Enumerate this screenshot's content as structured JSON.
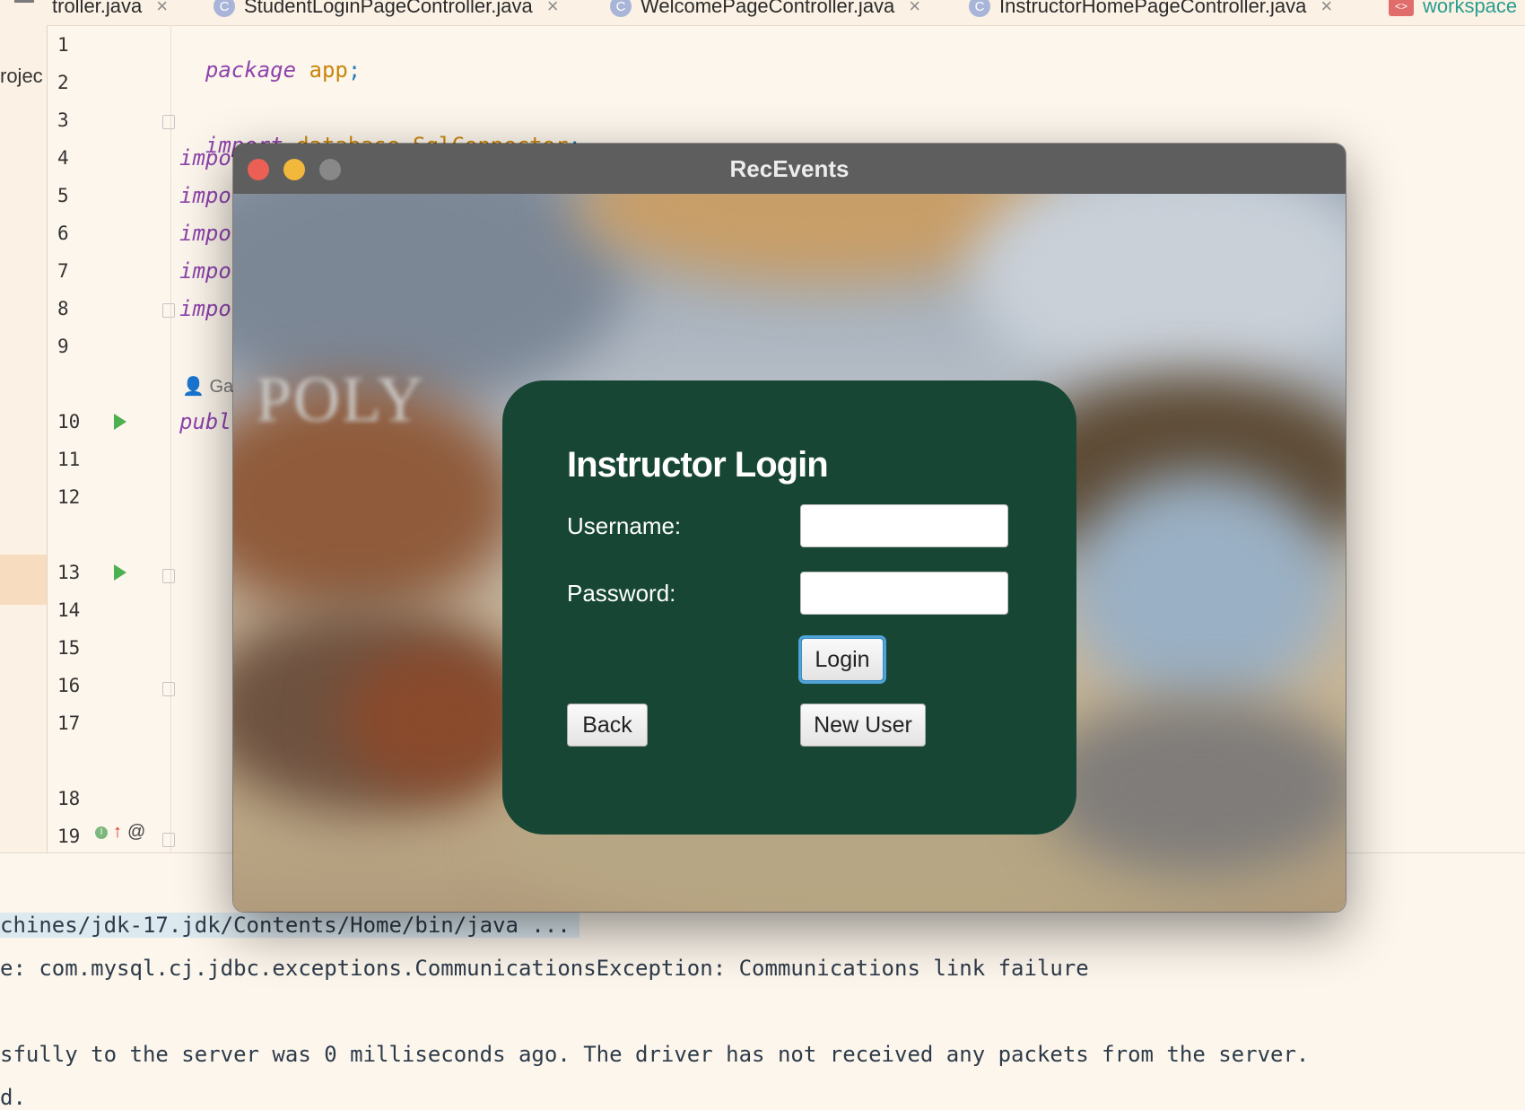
{
  "ide": {
    "tabs": [
      {
        "label": "troller.java",
        "icon": "class-icon"
      },
      {
        "label": "StudentLoginPageController.java",
        "icon": "class-icon"
      },
      {
        "label": "WelcomePageController.java",
        "icon": "class-icon"
      },
      {
        "label": "InstructorHomePageController.java",
        "icon": "class-icon"
      },
      {
        "label": "workspace",
        "icon": "xml-icon"
      }
    ],
    "project_label": "rojec",
    "line_numbers": [
      "1",
      "2",
      "3",
      "4",
      "5",
      "6",
      "7",
      "8",
      "9",
      "10",
      "11",
      "12",
      "13",
      "14",
      "15",
      "16",
      "17",
      "18",
      "19"
    ],
    "code": {
      "line1_kw": "package",
      "line1_pkg": "app",
      "line3_kw": "import",
      "line3_pkg": "database.SqlConnector",
      "semi": ";",
      "impo": "impo",
      "publ": "publ"
    },
    "author_hint": "Gab",
    "gutter_at": "@",
    "console": {
      "line1": "chines/jdk-17.jdk/Contents/Home/bin/java ...",
      "line2": "e: com.mysql.cj.jdbc.exceptions.CommunicationsException: Communications link failure",
      "line3": "sfully to the server was 0 milliseconds ago. The driver has not received any packets from the server.",
      "line4": "d."
    }
  },
  "window": {
    "title": "RecEvents",
    "background_text": "POLY"
  },
  "login": {
    "title": "Instructor Login",
    "username_label": "Username:",
    "password_label": "Password:",
    "username_value": "",
    "password_value": "",
    "login_button": "Login",
    "back_button": "Back",
    "new_user_button": "New User"
  },
  "colors": {
    "card": "#174734",
    "focus_ring": "#4fa3d9",
    "ide_bg": "#fdf6ec"
  }
}
